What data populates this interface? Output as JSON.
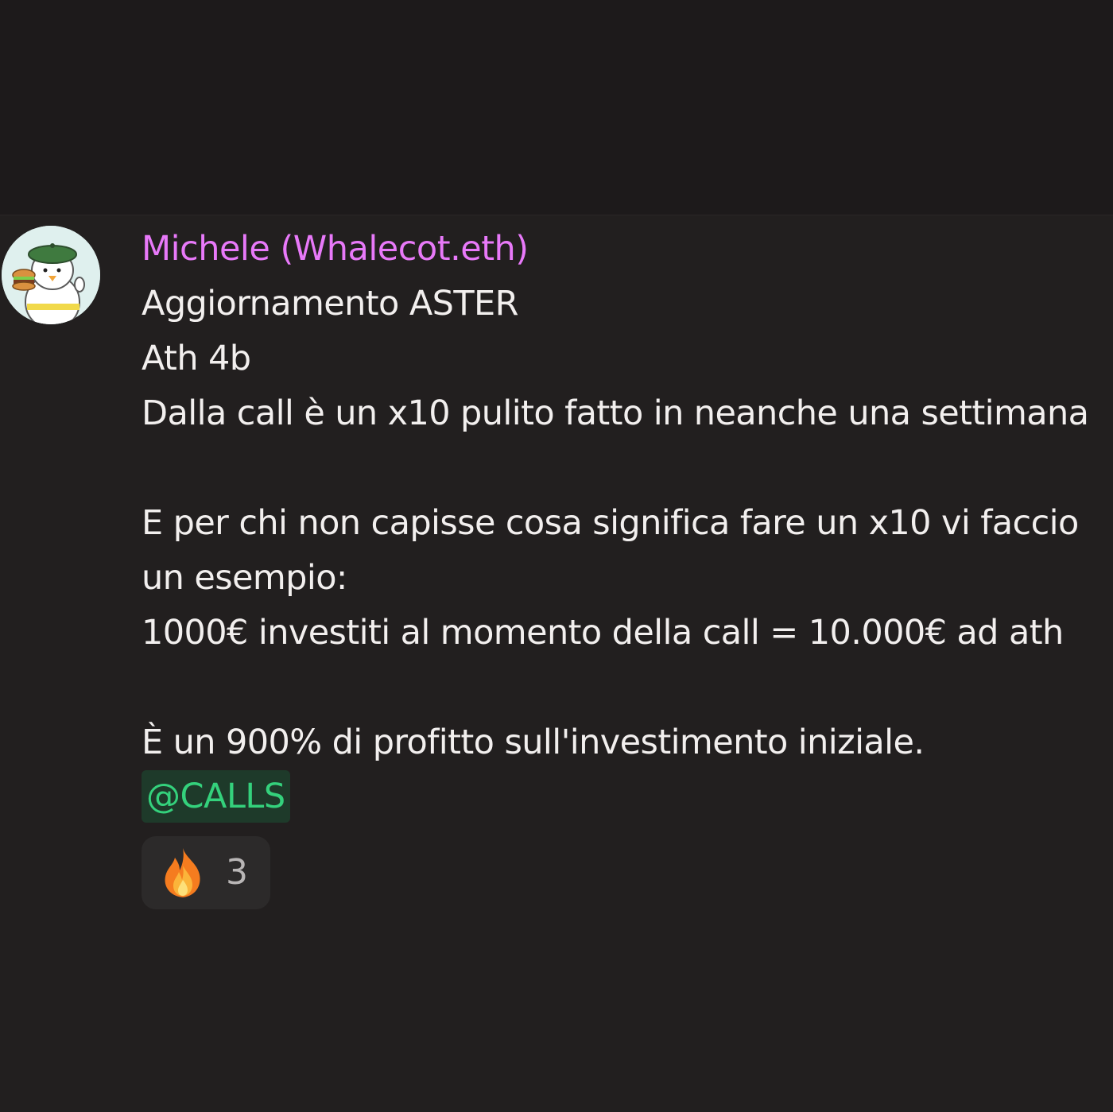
{
  "message": {
    "author": "Michele (Whalecot.eth)",
    "avatar_icon": "penguin-chef-avatar",
    "lines": [
      "Aggiornamento ASTER",
      "Ath 4b",
      "Dalla call è un x10 pulito fatto in neanche una settimana",
      "",
      "E per chi non capisse cosa significa fare un x10 vi faccio",
      "un esempio:",
      "1000€ investiti al momento della call = 10.000€ ad ath",
      "",
      "È un 900% di profitto sull'investimento iniziale."
    ],
    "mention": "@CALLS"
  },
  "reaction": {
    "icon": "fire-icon",
    "count": "3"
  },
  "colors": {
    "author": "#e879f9",
    "mention_text": "#34d17c",
    "mention_bg": "#1e3a2a",
    "background": "#221f1f"
  }
}
